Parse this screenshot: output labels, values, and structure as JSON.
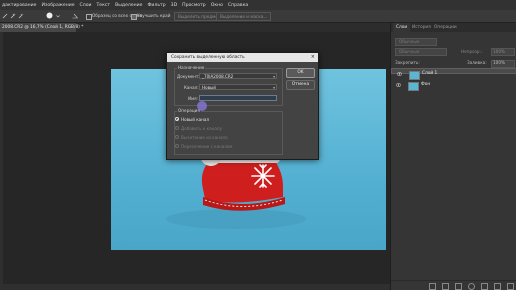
{
  "menubar": {
    "items": [
      "дактирование",
      "Изображение",
      "Слои",
      "Текст",
      "Выделение",
      "Фильтр",
      "3D",
      "Просмотр",
      "Окно",
      "Справка"
    ]
  },
  "options": {
    "sample_all_layers": "Образец со всех слоев",
    "enhance_edge": "Улучшить край",
    "select_subject": "Выделить предмет",
    "select_and_mask": "Выделение и маска..."
  },
  "document_tab": {
    "label": "2008.CR2 @ 16,7% (Слой 1, RGB/8) *"
  },
  "dialog": {
    "title": "Сохранить выделенную область",
    "close": "×",
    "destination_label": "Назначение",
    "document_label": "Документ:",
    "document_value": "_70IA2008.CR2",
    "channel_label": "Канал:",
    "channel_value": "Новый",
    "name_label": "Имя:",
    "name_value": "",
    "operation_label": "Операция",
    "operations": [
      {
        "label": "Новый канал",
        "checked": true
      },
      {
        "label": "Добавить к каналу",
        "checked": false
      },
      {
        "label": "Вычитание из канала",
        "checked": false
      },
      {
        "label": "Пересечение с каналом",
        "checked": false
      }
    ],
    "ok_label": "OK",
    "cancel_label": "Отмена"
  },
  "layers_panel": {
    "tabs": [
      "Слои",
      "История",
      "Операции"
    ],
    "kind_label": "Обычные",
    "blend_label": "Обычные",
    "opacity_label": "Непрозр.:",
    "opacity_value": "100%",
    "lock_label": "Закрепить:",
    "fill_label": "Заливка:",
    "fill_value": "100%",
    "layers": [
      {
        "name": "Слой 1",
        "selected": true
      },
      {
        "name": "Фон",
        "selected": false
      }
    ]
  },
  "colors": {
    "photo_bg": "#5bb6d6",
    "boot_red": "#d42222",
    "dialog_bg": "#434343",
    "ok_button": "#5a5a5a"
  }
}
